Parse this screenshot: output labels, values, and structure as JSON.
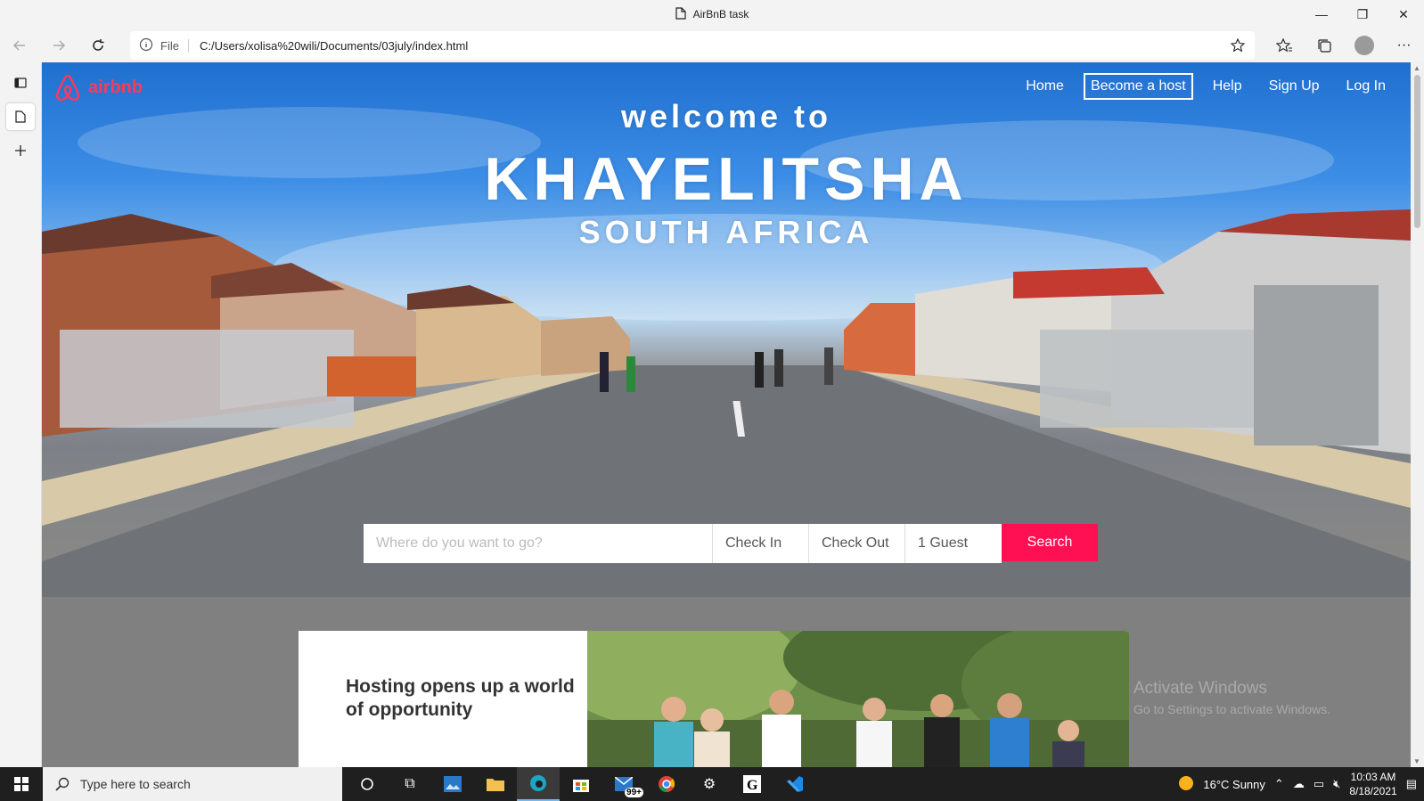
{
  "window": {
    "title": "AirBnB task",
    "controls": [
      "—",
      "❐",
      "✕"
    ]
  },
  "toolbar": {
    "info_label": "File",
    "url": "C:/Users/xolisa%20wili/Documents/03july/index.html"
  },
  "page": {
    "logo_text": "airbnb",
    "nav": {
      "home": "Home",
      "host": "Become a host",
      "help": "Help",
      "signup": "Sign Up",
      "login": "Log In"
    },
    "hero": {
      "line1": "welcome to",
      "line2": "KHAYELITSHA",
      "line3": "SOUTH AFRICA"
    },
    "search": {
      "destination_placeholder": "Where do you want to go?",
      "check_in": "Check In",
      "check_out": "Check Out",
      "guests": "1 Guest",
      "button": "Search"
    },
    "card": {
      "heading": "Hosting opens up a world of opportunity"
    }
  },
  "os": {
    "watermark_title": "Activate Windows",
    "watermark_sub": "Go to Settings to activate Windows.",
    "taskbar_search": "Type here to search",
    "mail_badge": "99+",
    "weather": "16°C  Sunny",
    "time": "10:03 AM",
    "date": "8/18/2021"
  },
  "colors": {
    "brand": "#ff385c",
    "search_button": "#ff1053",
    "section_bg": "#808080"
  }
}
